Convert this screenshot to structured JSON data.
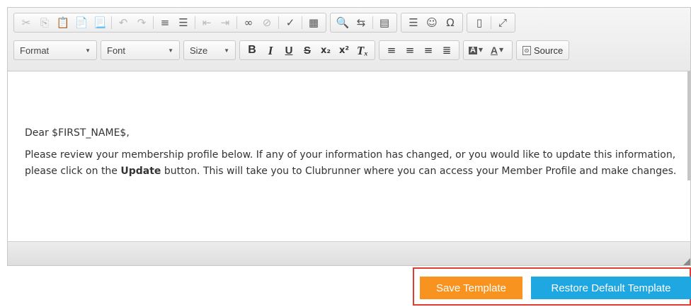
{
  "toolbar": {
    "row1": [
      {
        "group": [
          {
            "name": "cut-icon",
            "glyph": "✂",
            "disabled": true
          },
          {
            "name": "copy-icon",
            "glyph": "⎘",
            "disabled": true
          },
          {
            "name": "paste-icon",
            "glyph": "📋",
            "disabled": false
          },
          {
            "name": "paste-text-icon",
            "glyph": "📄",
            "disabled": false
          },
          {
            "name": "paste-word-icon",
            "glyph": "📃",
            "disabled": false
          },
          {
            "sep": true
          },
          {
            "name": "undo-icon",
            "glyph": "↶",
            "disabled": true
          },
          {
            "name": "redo-icon",
            "glyph": "↷",
            "disabled": true
          },
          {
            "sep": true
          },
          {
            "name": "numbered-list-icon",
            "glyph": "≡",
            "disabled": false
          },
          {
            "name": "bulleted-list-icon",
            "glyph": "☰",
            "disabled": false
          },
          {
            "sep": true
          },
          {
            "name": "decrease-indent-icon",
            "glyph": "⇤",
            "disabled": true
          },
          {
            "name": "increase-indent-icon",
            "glyph": "⇥",
            "disabled": true
          },
          {
            "sep": true
          },
          {
            "name": "link-icon",
            "glyph": "∞",
            "disabled": false
          },
          {
            "name": "unlink-icon",
            "glyph": "⊘",
            "disabled": true
          },
          {
            "sep": true
          },
          {
            "name": "spellcheck-icon",
            "glyph": "✓",
            "disabled": false
          },
          {
            "sep": true
          },
          {
            "name": "table-icon",
            "glyph": "▦",
            "disabled": false
          }
        ]
      },
      {
        "group": [
          {
            "name": "find-icon",
            "glyph": "🔍",
            "disabled": false
          },
          {
            "name": "replace-icon",
            "glyph": "⇆",
            "disabled": false
          },
          {
            "sep": true
          },
          {
            "name": "page-break-icon",
            "glyph": "▤",
            "disabled": false
          }
        ]
      },
      {
        "group": [
          {
            "name": "horizontal-rule-icon",
            "glyph": "☰",
            "disabled": false
          },
          {
            "name": "smiley-icon",
            "glyph": "☺",
            "disabled": false
          },
          {
            "name": "special-char-icon",
            "glyph": "Ω",
            "disabled": false
          }
        ]
      },
      {
        "group": [
          {
            "name": "show-blocks-icon",
            "glyph": "▯",
            "disabled": false
          },
          {
            "sep": true
          },
          {
            "name": "maximize-icon",
            "glyph": "⤢",
            "disabled": false
          }
        ]
      }
    ],
    "format_label": "Format",
    "font_label": "Font",
    "size_label": "Size",
    "format_buttons": [
      {
        "name": "bold-icon",
        "glyph": "B",
        "cls": "bold"
      },
      {
        "name": "italic-icon",
        "glyph": "I",
        "cls": "ital"
      },
      {
        "name": "underline-icon",
        "glyph": "U",
        "cls": "under"
      },
      {
        "name": "strikethrough-icon",
        "glyph": "S",
        "cls": "strike"
      },
      {
        "name": "subscript-icon",
        "glyph": "x₂",
        "cls": "small"
      },
      {
        "name": "superscript-icon",
        "glyph": "x²",
        "cls": "small"
      },
      {
        "name": "remove-format-icon",
        "glyph": "Tₓ",
        "cls": "ital"
      }
    ],
    "align_buttons": [
      {
        "name": "align-left-icon",
        "glyph": "≡"
      },
      {
        "name": "align-center-icon",
        "glyph": "≡"
      },
      {
        "name": "align-right-icon",
        "glyph": "≡"
      },
      {
        "name": "align-justify-icon",
        "glyph": "≣"
      }
    ],
    "source_label": "Source"
  },
  "content": {
    "greeting": "Dear $FIRST_NAME$,",
    "body_before": "Please review your membership profile below. If any of your information has changed, or you would like to update this information, please click on the ",
    "body_bold": "Update",
    "body_after": " button. This will take you to Clubrunner where you can access your Member Profile and make changes."
  },
  "actions": {
    "save_label": "Save Template",
    "restore_label": "Restore Default Template",
    "save_color": "#f7931e",
    "restore_color": "#1ea7e1"
  }
}
